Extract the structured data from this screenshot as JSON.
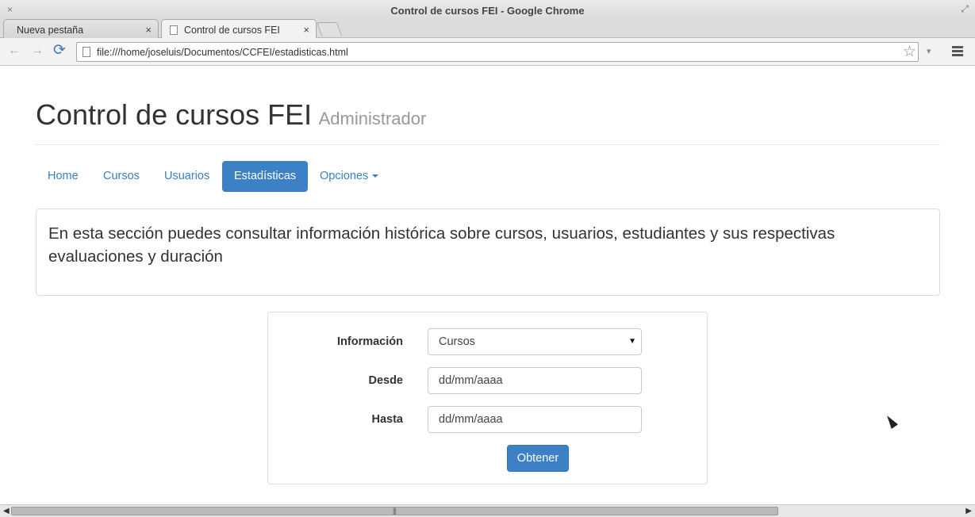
{
  "window": {
    "title": "Control de cursos FEI - Google Chrome"
  },
  "tabs": [
    {
      "label": "Nueva pestaña",
      "active": false
    },
    {
      "label": "Control de cursos FEI",
      "active": true
    }
  ],
  "toolbar": {
    "url": "file:///home/joseluis/Documentos/CCFEI/estadisticas.html"
  },
  "header": {
    "title": "Control de cursos FEI",
    "subtitle": "Administrador"
  },
  "nav": {
    "items": [
      {
        "label": "Home",
        "active": false
      },
      {
        "label": "Cursos",
        "active": false
      },
      {
        "label": "Usuarios",
        "active": false
      },
      {
        "label": "Estadísticas",
        "active": true
      },
      {
        "label": "Opciones",
        "active": false,
        "dropdown": true
      }
    ]
  },
  "info": {
    "text": "En esta sección puedes consultar información histórica sobre cursos, usuarios, estudiantes y sus respectivas evaluaciones y duración"
  },
  "form": {
    "info_label": "Información",
    "info_value": "Cursos",
    "from_label": "Desde",
    "from_value": "dd/mm/aaaa",
    "to_label": "Hasta",
    "to_value": "dd/mm/aaaa",
    "submit_label": "Obtener"
  },
  "colors": {
    "primary": "#3c80c5",
    "link": "#3a7fc1"
  },
  "icons": {
    "window_close": "×",
    "tab_close": "×",
    "back": "←",
    "forward": "→",
    "reload": "⟳",
    "bookmark": "☆",
    "dropdown": "▾",
    "select_arrow": "▼",
    "scroll_left": "◀",
    "scroll_right": "▶",
    "scroll_grip": "|||",
    "maximize": "⤢"
  }
}
